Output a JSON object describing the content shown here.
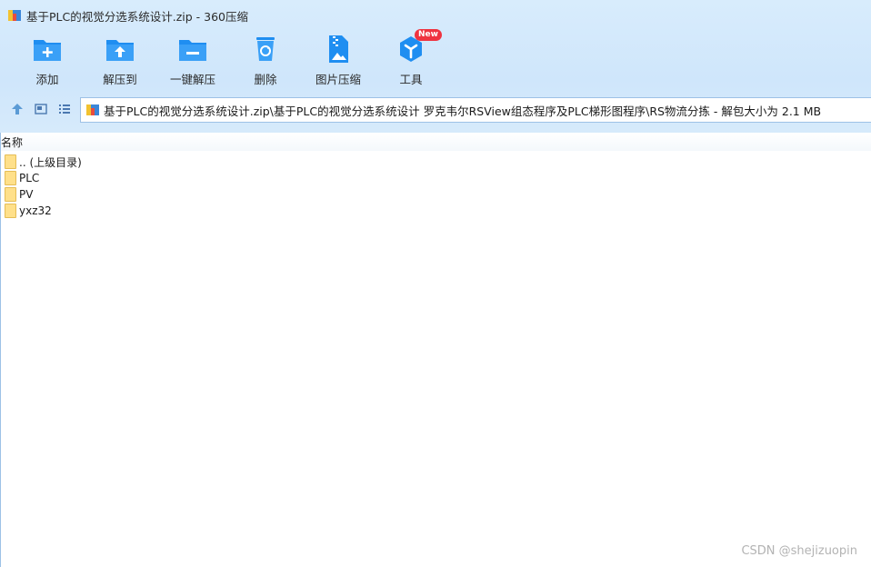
{
  "window": {
    "title": "基于PLC的视觉分选系统设计.zip - 360压缩"
  },
  "toolbar": {
    "items": [
      {
        "label": "添加",
        "icon": "add-folder-icon"
      },
      {
        "label": "解压到",
        "icon": "extract-folder-icon"
      },
      {
        "label": "一键解压",
        "icon": "one-click-extract-icon"
      },
      {
        "label": "删除",
        "icon": "recycle-bin-icon"
      },
      {
        "label": "图片压缩",
        "icon": "image-compress-icon"
      },
      {
        "label": "工具",
        "icon": "tools-cube-icon",
        "badge": "New"
      }
    ]
  },
  "nav": {
    "icons": [
      "up-arrow-icon",
      "thumbnail-view-icon",
      "list-view-icon"
    ]
  },
  "address": {
    "path": "基于PLC的视觉分选系统设计.zip\\基于PLC的视觉分选系统设计 罗克韦尔RSView组态程序及PLC梯形图程序\\RS物流分拣 - 解包大小为 2.1 MB"
  },
  "list": {
    "header": "名称",
    "rows": [
      {
        "name": ".. (上级目录)"
      },
      {
        "name": "PLC"
      },
      {
        "name": "PV"
      },
      {
        "name": "yxz32"
      }
    ]
  },
  "watermark": "CSDN @shejizuopin",
  "colors": {
    "accent_blue": "#1f8ef1",
    "toolbar_bg": "#d3e8fb",
    "badge_red": "#ef3340",
    "folder_yellow": "#ffe08a"
  }
}
